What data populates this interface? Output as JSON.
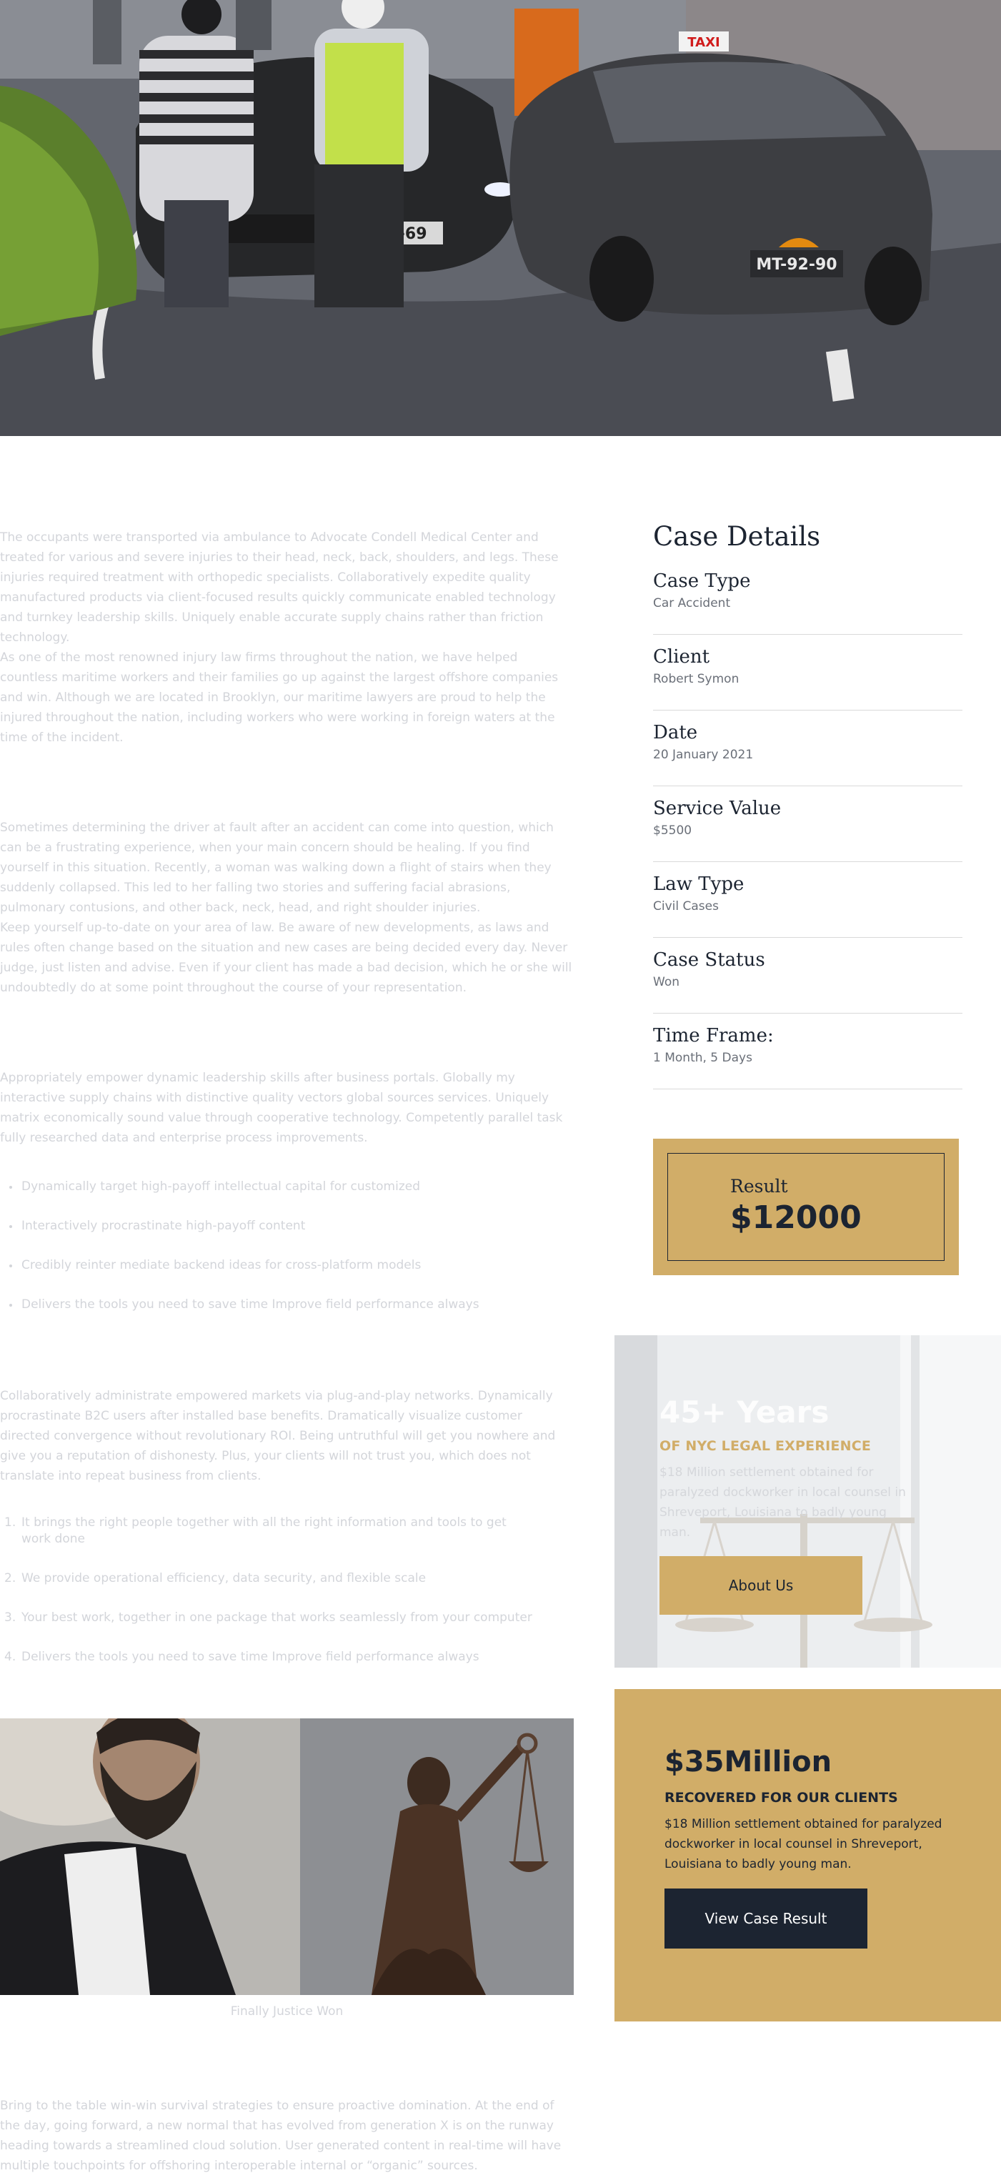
{
  "hero": {
    "image": "car-accident-photo",
    "sign_taxi": "TAXI",
    "plate_left": "1-69",
    "plate_right": "MT-92-90"
  },
  "content": {
    "p1": [
      "The occupants were transported via ambulance to Advocate Condell Medical Center and treated for various and severe injuries to their head, neck, back, shoulders, and legs. These injuries required treatment with orthopedic specialists. Collaboratively expedite quality manufactured products via client-focused results quickly communicate enabled technology and turnkey leadership skills. Uniquely enable accurate supply chains rather than friction technology.",
      "As one of the most renowned injury law firms throughout the nation, we have helped countless maritime workers and their families go up against the largest offshore companies and win. Although we are located in Brooklyn, our maritime lawyers are proud to help the injured throughout the nation, including workers who were working in foreign waters at the time of the incident."
    ],
    "p2": [
      "Sometimes determining the driver at fault after an accident can come into question, which can be a frustrating experience, when your main concern should be healing. If you find yourself in this situation. Recently, a woman was walking down a flight of stairs when they suddenly collapsed. This led to her falling two stories and suffering facial abrasions, pulmonary contusions, and other back, neck, head, and right shoulder injuries.",
      "Keep yourself up-to-date on your area of law. Be aware of new developments, as laws and rules often change based on the situation and new cases are being decided every day. Never judge, just listen and advise. Even if your client has made a bad decision, which he or she will undoubtedly do at some point throughout the course of your representation."
    ],
    "p3": "Appropriately empower dynamic leadership skills after business portals. Globally my interactive supply chains with distinctive quality vectors global sources services. Uniquely matrix economically sound value through cooperative technology. Competently parallel task fully researched data and enterprise process improvements.",
    "bullets": [
      "Dynamically target high-payoff intellectual capital for customized",
      "Interactively procrastinate high-payoff content",
      "Credibly reinter mediate backend ideas for cross-platform models",
      "Delivers the tools you need to save time Improve field performance always"
    ],
    "p4": "Collaboratively administrate empowered markets via plug-and-play networks. Dynamically procrastinate B2C users after installed base benefits. Dramatically visualize customer directed convergence without revolutionary ROI. Being untruthful will get you nowhere and give you a reputation of dishonesty. Plus, your clients will not trust you, which does not translate into repeat business from clients.",
    "numbered": [
      {
        "num": "1.",
        "text": "It brings the right people together with all the right information and tools to get work done"
      },
      {
        "num": "2.",
        "text": "We provide operational efficiency, data security, and flexible scale"
      },
      {
        "num": "3.",
        "text": "Your best work, together in one package that works seamlessly from your computer"
      },
      {
        "num": "4.",
        "text": "Delivers the tools you need to save time Improve field performance always"
      }
    ],
    "caption": "Finally Justice Won",
    "p5": "Bring to the table win-win survival strategies to ensure proactive domination. At the end of the day, going forward, a new normal that has evolved from generation X is on the runway heading towards a streamlined cloud solution. User generated content in real-time will have multiple touchpoints for offshoring interoperable internal or “organic” sources."
  },
  "case_details": {
    "title": "Case Details",
    "items": [
      {
        "label": "Case Type",
        "value": "Car Accident"
      },
      {
        "label": "Client",
        "value": "Robert Symon"
      },
      {
        "label": "Date",
        "value": "20 January 2021"
      },
      {
        "label": "Service Value",
        "value": "$5500"
      },
      {
        "label": "Law Type",
        "value": "Civil  Cases"
      },
      {
        "label": "Case Status",
        "value": "Won"
      },
      {
        "label": "Time Frame:",
        "value": "1 Month, 5 Days"
      }
    ]
  },
  "result": {
    "label": "Result",
    "value": "$12000"
  },
  "experience": {
    "title": "45+ Years",
    "subtitle": "OF NYC LEGAL EXPERIENCE",
    "text": "$18 Million settlement obtained for paralyzed dockworker in  local counsel in Shreveport, Louisiana to  badly young man.",
    "button": "About  Us"
  },
  "recovered": {
    "title": "$35Million",
    "subtitle": "RECOVERED FOR OUR CLIENTS",
    "text": "$18 Million settlement obtained for paralyzed dockworker in  local counsel in Shreveport, Louisiana to  badly young man.",
    "button": "View Case Result"
  },
  "colors": {
    "gold": "#d1ad68",
    "navy": "#1c2431",
    "muted_text": "#d3d5da"
  }
}
